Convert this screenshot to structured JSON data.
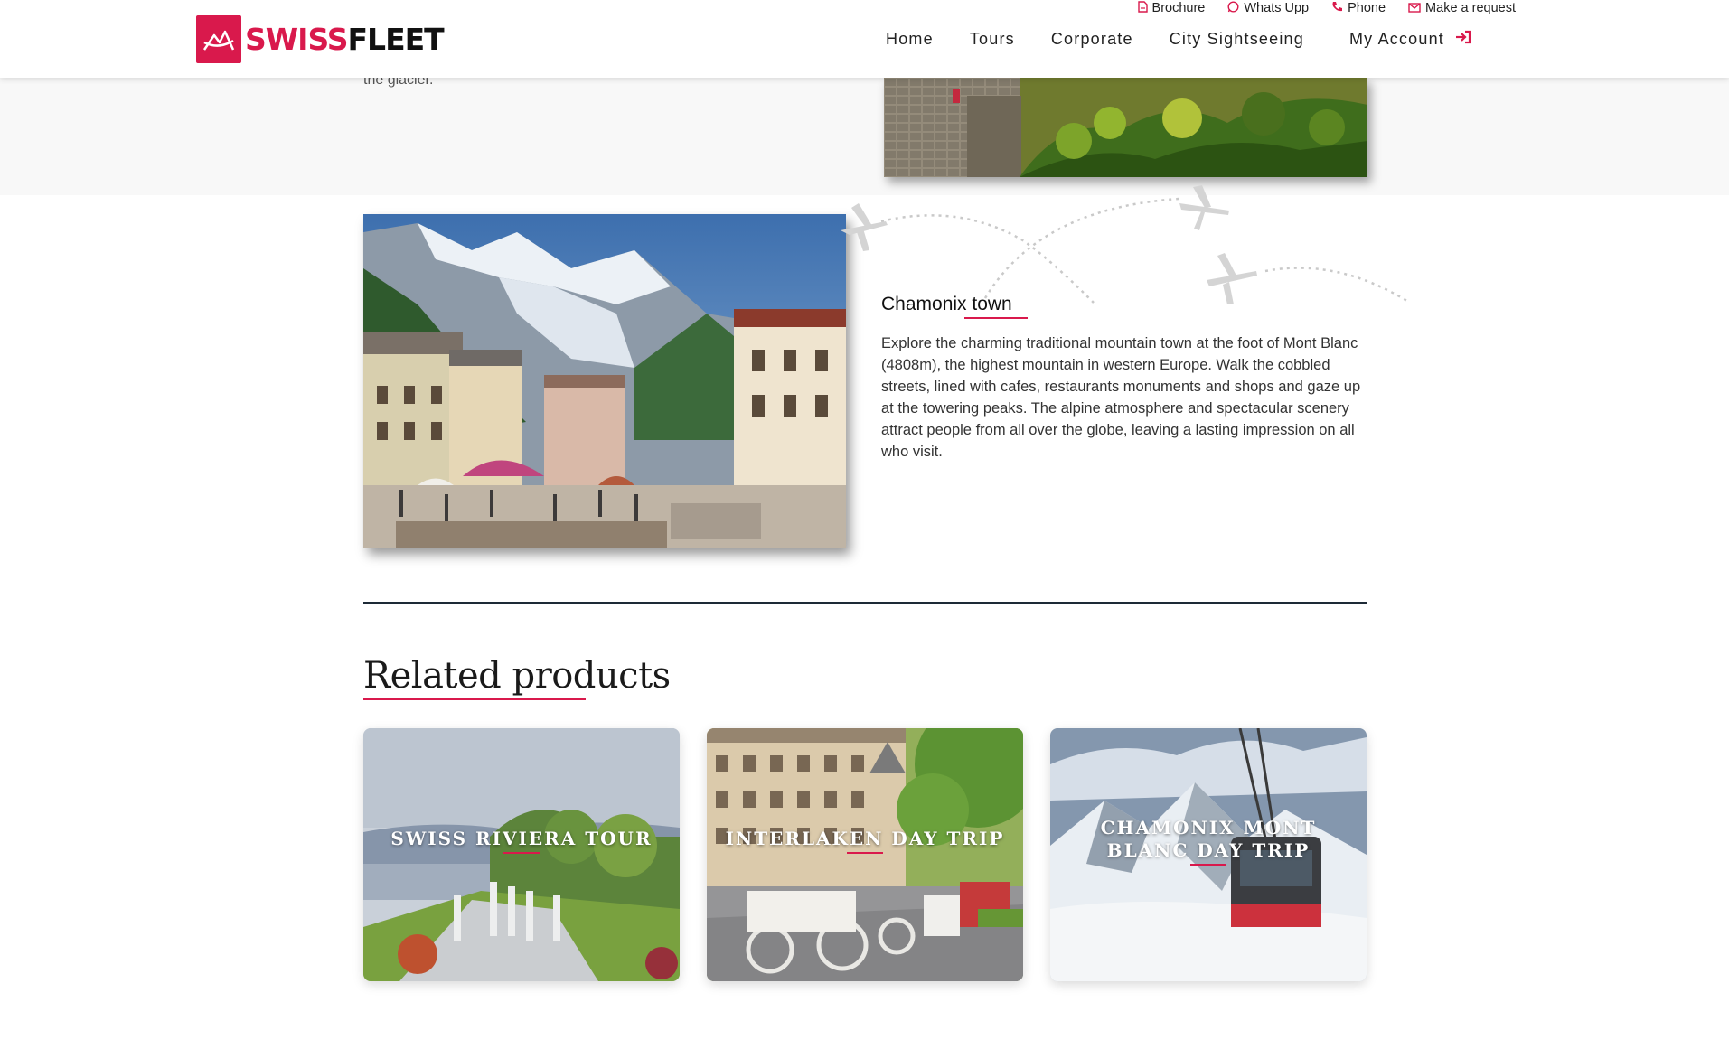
{
  "brand": {
    "name_part1": "SWISS",
    "name_part2": "FLEET",
    "accent": "#d9194c"
  },
  "topbar": {
    "brochure": "Brochure",
    "whatsapp": "Whats Upp",
    "phone": "Phone",
    "request": "Make a request"
  },
  "nav": {
    "items": [
      "Home",
      "Tours",
      "Corporate",
      "City Sightseeing"
    ],
    "account": "My Account"
  },
  "previous_section": {
    "text": "the glacier."
  },
  "chamonix": {
    "title": "Chamonix town",
    "description": "Explore the charming traditional mountain town at the foot of Mont Blanc (4808m), the highest mountain in western Europe. Walk the cobbled streets, lined with cafes, restaurants monuments and shops and gaze up at the towering peaks. The alpine atmosphere and spectacular scenery attract people from all over the globe, leaving a lasting impression on all who visit."
  },
  "related": {
    "title": "Related products",
    "cards": [
      {
        "label": "SWISS RIVIERA TOUR"
      },
      {
        "label": "INTERLAKEN DAY TRIP"
      },
      {
        "label": "CHAMONIX MONT BLANC DAY TRIP"
      }
    ]
  },
  "icons": {
    "brochure": "pdf-file-icon",
    "whatsapp": "whatsapp-icon",
    "phone": "phone-icon",
    "request": "envelope-icon",
    "account": "sign-in-icon"
  }
}
